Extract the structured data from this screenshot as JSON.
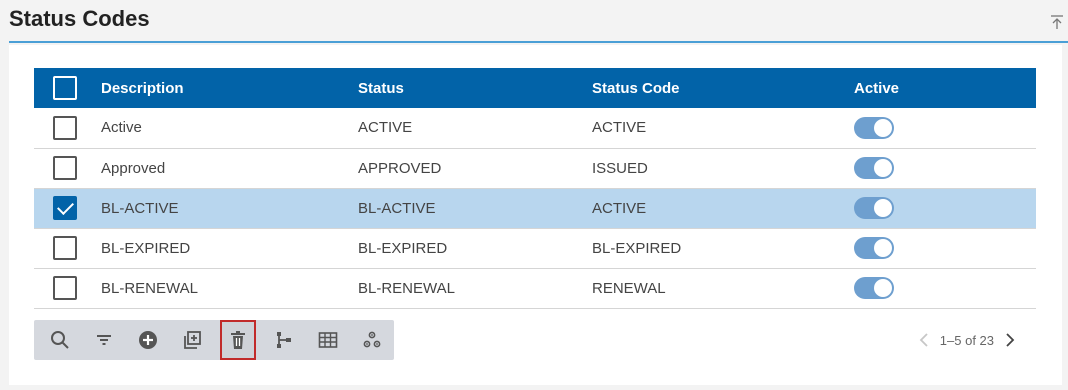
{
  "header": {
    "title": "Status Codes",
    "collapse_icon": "collapse-up-icon"
  },
  "table": {
    "columns": [
      "Description",
      "Status",
      "Status Code",
      "Active"
    ],
    "rows": [
      {
        "description": "Active",
        "status": "ACTIVE",
        "status_code": "ACTIVE",
        "active": true,
        "selected": false
      },
      {
        "description": "Approved",
        "status": "APPROVED",
        "status_code": "ISSUED",
        "active": true,
        "selected": false
      },
      {
        "description": "BL-ACTIVE",
        "status": "BL-ACTIVE",
        "status_code": "ACTIVE",
        "active": true,
        "selected": true
      },
      {
        "description": "BL-EXPIRED",
        "status": "BL-EXPIRED",
        "status_code": "BL-EXPIRED",
        "active": true,
        "selected": false
      },
      {
        "description": "BL-RENEWAL",
        "status": "BL-RENEWAL",
        "status_code": "RENEWAL",
        "active": true,
        "selected": false
      }
    ]
  },
  "toolbar": {
    "buttons": [
      {
        "icon": "search-icon"
      },
      {
        "icon": "filter-icon"
      },
      {
        "icon": "add-circle-icon"
      },
      {
        "icon": "copy-add-icon"
      },
      {
        "icon": "delete-icon",
        "active": true
      },
      {
        "icon": "hierarchy-icon"
      },
      {
        "icon": "grid-icon"
      },
      {
        "icon": "settings-icon"
      }
    ]
  },
  "pager": {
    "text": "1–5 of 23"
  },
  "colors": {
    "header_blue": "#0263a8",
    "selected_row": "#b8d6ee",
    "toggle_on": "#6e9fcf",
    "accent_line": "#4a9fd6",
    "active_outline": "#c12a2a"
  }
}
